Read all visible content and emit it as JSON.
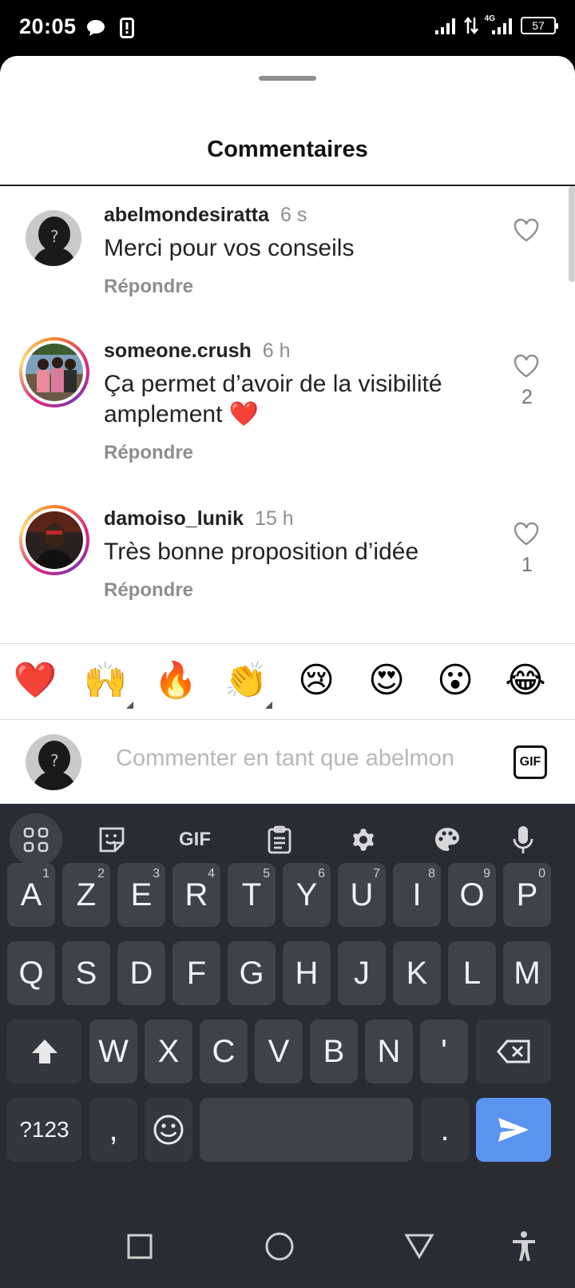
{
  "status_bar": {
    "time": "20:05",
    "network_label": "4G",
    "battery": "57"
  },
  "sheet": {
    "title": "Commentaires"
  },
  "comments": [
    {
      "username": "abelmondesiratta",
      "time": "6 s",
      "text": "Merci pour vos conseils",
      "reply": "Répondre",
      "likes": ""
    },
    {
      "username": "someone.crush",
      "time": "6 h",
      "text": "Ça permet d’avoir de la visibilité amplement ❤️",
      "reply": "Répondre",
      "likes": "2"
    },
    {
      "username": "damoiso_lunik",
      "time": "15 h",
      "text": "Très bonne proposition d’idée",
      "reply": "Répondre",
      "likes": "1"
    }
  ],
  "reactions": [
    "❤️",
    "🙌",
    "🔥",
    "👏",
    "😢",
    "😍",
    "😮",
    "😂"
  ],
  "comment_input": {
    "placeholder": "Commenter en tant que abelmon",
    "gif_label": "GIF"
  },
  "keyboard": {
    "toolbar": [
      "apps-icon",
      "sticker-icon",
      "gif-icon",
      "clipboard-icon",
      "settings-icon",
      "palette-icon",
      "mic-icon"
    ],
    "toolbar_gif_label": "GIF",
    "row1": [
      {
        "label": "A",
        "hint": "1"
      },
      {
        "label": "Z",
        "hint": "2"
      },
      {
        "label": "E",
        "hint": "3"
      },
      {
        "label": "R",
        "hint": "4"
      },
      {
        "label": "T",
        "hint": "5"
      },
      {
        "label": "Y",
        "hint": "6"
      },
      {
        "label": "U",
        "hint": "7"
      },
      {
        "label": "I",
        "hint": "8"
      },
      {
        "label": "O",
        "hint": "9"
      },
      {
        "label": "P",
        "hint": "0"
      }
    ],
    "row2": [
      "Q",
      "S",
      "D",
      "F",
      "G",
      "H",
      "J",
      "K",
      "L",
      "M"
    ],
    "row3": [
      "W",
      "X",
      "C",
      "V",
      "B",
      "N",
      "'"
    ],
    "symbols_label": "?123",
    "comma_label": ",",
    "period_label": "."
  },
  "colors": {
    "send_key": "#5b94f0",
    "key": "#3f4349",
    "keyboard_bg": "#292c31"
  }
}
